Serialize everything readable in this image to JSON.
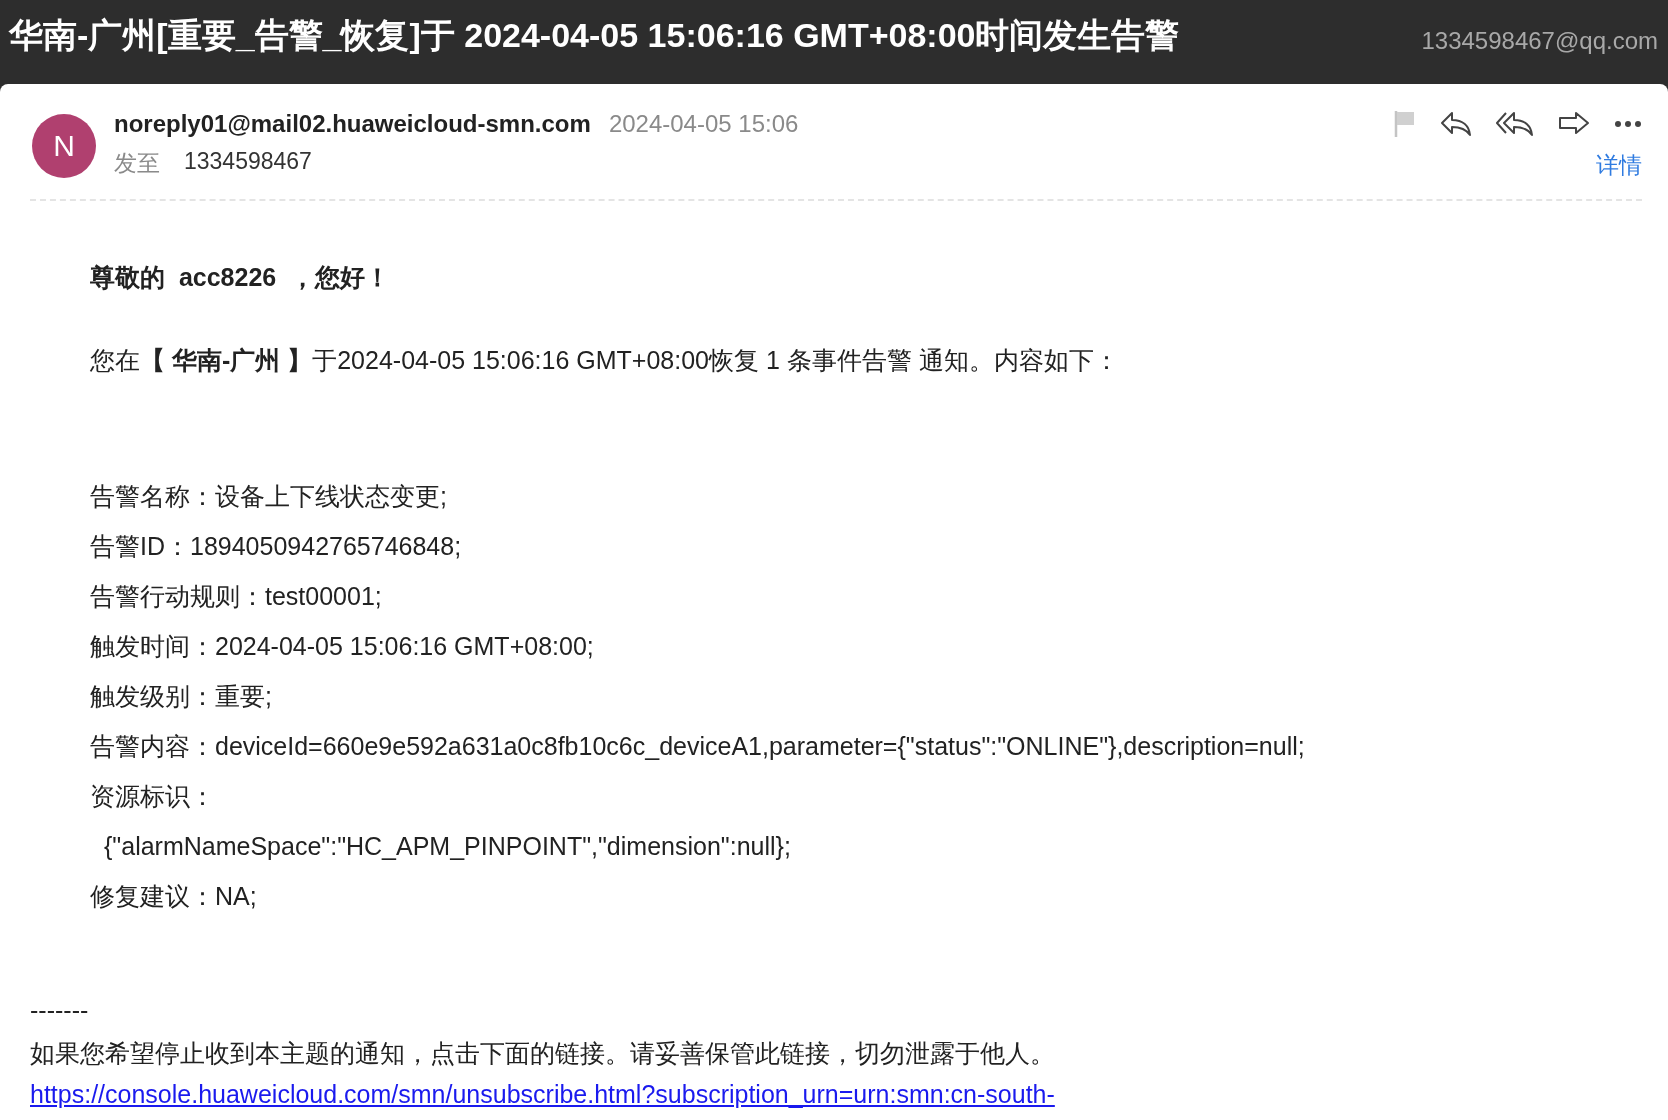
{
  "window": {
    "title": "华南-广州[重要_告警_恢复]于 2024-04-05 15:06:16 GMT+08:00时间发生告警",
    "account": "1334598467@qq.com"
  },
  "message": {
    "avatar_letter": "N",
    "sender": "noreply01@mail02.huaweicloud-smn.com",
    "date": "2024-04-05 15:06",
    "to_label": "发至",
    "to": "1334598467",
    "details_link": "详情"
  },
  "body": {
    "greeting": "尊敬的  acc8226  ，您好！",
    "intro": "您在**【 华南-广州 】**于2024-04-05 15:06:16 GMT+08:00恢复 1 条事件告警 通知。内容如下：",
    "lines": [
      {
        "kind": "line",
        "text": "告警名称：设备上下线状态变更;"
      },
      {
        "kind": "line",
        "text": "告警ID：1894050942765746848;"
      },
      {
        "kind": "line",
        "text": "告警行动规则：test00001;"
      },
      {
        "kind": "line",
        "text": "触发时间：2024-04-05 15:06:16 GMT+08:00;"
      },
      {
        "kind": "line",
        "text": "触发级别：重要;"
      },
      {
        "kind": "line",
        "text": "告警内容：deviceId=660e9e592a631a0c8fb10c6c_deviceA1,parameter={\"status\":\"ONLINE\"},description=null;"
      },
      {
        "kind": "line",
        "text": "资源标识："
      },
      {
        "kind": "continuation",
        "text": "{\"alarmNameSpace\":\"HC_APM_PINPOINT\",\"dimension\":null};"
      },
      {
        "kind": "line",
        "text": "修复建议：NA;"
      }
    ],
    "separator": "-------",
    "notice": "如果您希望停止收到本主题的通知，点击下面的链接。请妥善保管此链接，切勿泄露于他人。",
    "link": "https://console.huaweicloud.com/smn/unsubscribe.html?subscription_urn=urn:smn:cn-south-"
  }
}
